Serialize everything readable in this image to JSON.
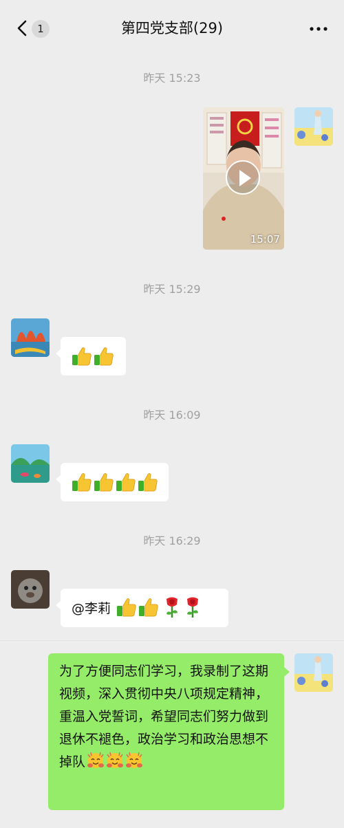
{
  "header": {
    "badge": "1",
    "title": "第四党支部(29)"
  },
  "messages": {
    "t1": "昨天 15:23",
    "video_duration": "15:07",
    "t2": "昨天 15:29",
    "t3": "昨天 16:09",
    "t4": "昨天 16:29",
    "mention": "@李莉",
    "long_text": "为了方便同志们学习，我录制了这期视频，深入贯彻中央八项规定精神，重温入党誓词，希望同志们努力做到退休不褪色，政治学习和政治思想不掉队"
  },
  "icons": [
    "back-arrow-icon",
    "more-icon",
    "play-icon",
    "thumbs-up-icon",
    "rose-icon",
    "smiley-icon"
  ],
  "colors": {
    "background": "#ededed",
    "my_bubble": "#95ec69",
    "other_bubble": "#ffffff"
  }
}
